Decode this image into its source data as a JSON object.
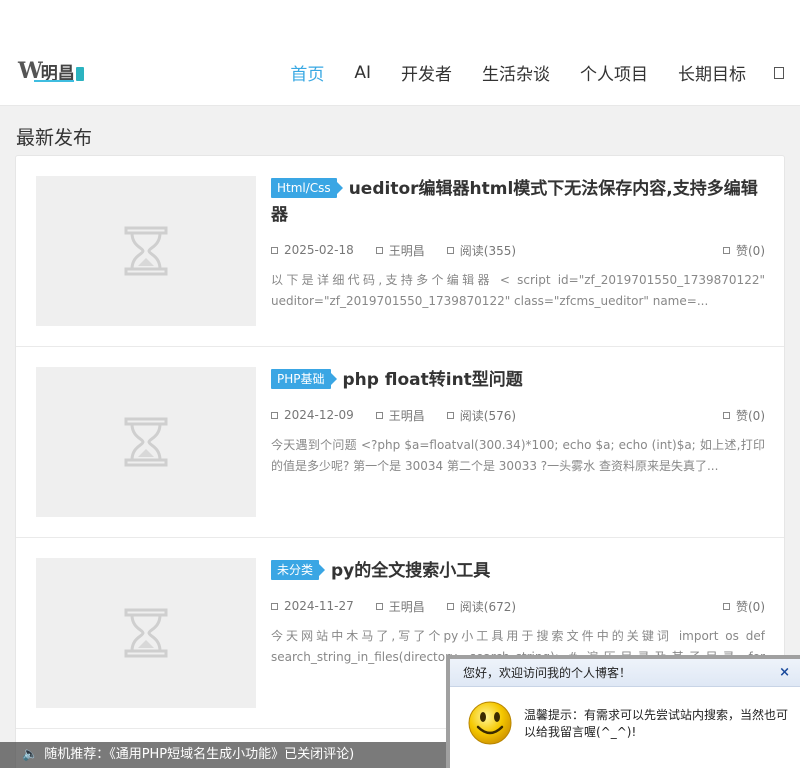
{
  "header": {
    "logo": {
      "letter": "W",
      "text": "明昌"
    },
    "nav": [
      {
        "label": "首页",
        "active": true
      },
      {
        "label": "AI",
        "active": false
      },
      {
        "label": "开发者",
        "active": false
      },
      {
        "label": "生活杂谈",
        "active": false
      },
      {
        "label": "个人项目",
        "active": false
      },
      {
        "label": "长期目标",
        "active": false
      }
    ]
  },
  "section_title": "最新发布",
  "posts": [
    {
      "tag": "Html/Css",
      "title": "ueditor编辑器html模式下无法保存内容,支持多编辑器",
      "date": "2025-02-18",
      "author": "王明昌",
      "reads": "阅读(355)",
      "likes": "赞(0)",
      "excerpt": "以下是详细代码,支持多个编辑器 < script id=\"zf_2019701550_1739870122\" ueditor=\"zf_2019701550_1739870122\" class=\"zfcms_ueditor\" name=..."
    },
    {
      "tag": "PHP基础",
      "title": "php float转int型问题",
      "date": "2024-12-09",
      "author": "王明昌",
      "reads": "阅读(576)",
      "likes": "赞(0)",
      "excerpt": "今天遇到个问题 <?php $a=floatval(300.34)*100; echo $a; echo (int)$a; 如上述,打印的值是多少呢? 第一个是 30034 第二个是 30033 ?一头雾水 查资料原来是失真了..."
    },
    {
      "tag": "未分类",
      "title": "py的全文搜索小工具",
      "date": "2024-11-27",
      "author": "王明昌",
      "reads": "阅读(672)",
      "likes": "赞(0)",
      "excerpt": "今天网站中木马了,写了个py小工具用于搜索文件中的关键词 import os def search_string_in_files(directory, search_string): # 遍历目录及其子目录 for foldername,..."
    }
  ],
  "bottom_bar": {
    "text": "随机推荐：《通用PHP短域名生成小功能》已关闭评论)"
  },
  "popup": {
    "title": "您好，欢迎访问我的个人博客！",
    "close": "×",
    "message": "温馨提示：有需求可以先尝试站内搜索，当然也可以给我留言喔(^_^)!"
  }
}
